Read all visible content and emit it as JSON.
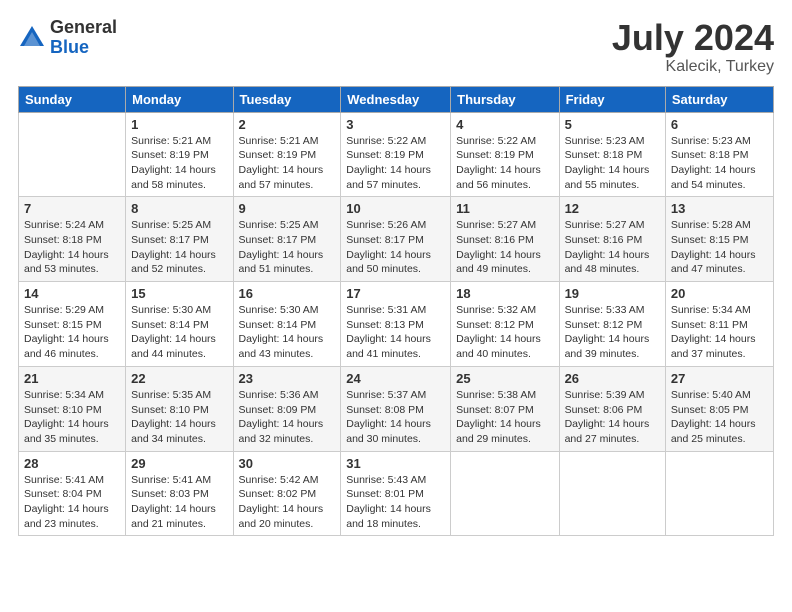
{
  "logo": {
    "general": "General",
    "blue": "Blue"
  },
  "title": {
    "month": "July 2024",
    "location": "Kalecik, Turkey"
  },
  "calendar": {
    "headers": [
      "Sunday",
      "Monday",
      "Tuesday",
      "Wednesday",
      "Thursday",
      "Friday",
      "Saturday"
    ],
    "weeks": [
      [
        {
          "day": "",
          "info": ""
        },
        {
          "day": "1",
          "info": "Sunrise: 5:21 AM\nSunset: 8:19 PM\nDaylight: 14 hours\nand 58 minutes."
        },
        {
          "day": "2",
          "info": "Sunrise: 5:21 AM\nSunset: 8:19 PM\nDaylight: 14 hours\nand 57 minutes."
        },
        {
          "day": "3",
          "info": "Sunrise: 5:22 AM\nSunset: 8:19 PM\nDaylight: 14 hours\nand 57 minutes."
        },
        {
          "day": "4",
          "info": "Sunrise: 5:22 AM\nSunset: 8:19 PM\nDaylight: 14 hours\nand 56 minutes."
        },
        {
          "day": "5",
          "info": "Sunrise: 5:23 AM\nSunset: 8:18 PM\nDaylight: 14 hours\nand 55 minutes."
        },
        {
          "day": "6",
          "info": "Sunrise: 5:23 AM\nSunset: 8:18 PM\nDaylight: 14 hours\nand 54 minutes."
        }
      ],
      [
        {
          "day": "7",
          "info": "Sunrise: 5:24 AM\nSunset: 8:18 PM\nDaylight: 14 hours\nand 53 minutes."
        },
        {
          "day": "8",
          "info": "Sunrise: 5:25 AM\nSunset: 8:17 PM\nDaylight: 14 hours\nand 52 minutes."
        },
        {
          "day": "9",
          "info": "Sunrise: 5:25 AM\nSunset: 8:17 PM\nDaylight: 14 hours\nand 51 minutes."
        },
        {
          "day": "10",
          "info": "Sunrise: 5:26 AM\nSunset: 8:17 PM\nDaylight: 14 hours\nand 50 minutes."
        },
        {
          "day": "11",
          "info": "Sunrise: 5:27 AM\nSunset: 8:16 PM\nDaylight: 14 hours\nand 49 minutes."
        },
        {
          "day": "12",
          "info": "Sunrise: 5:27 AM\nSunset: 8:16 PM\nDaylight: 14 hours\nand 48 minutes."
        },
        {
          "day": "13",
          "info": "Sunrise: 5:28 AM\nSunset: 8:15 PM\nDaylight: 14 hours\nand 47 minutes."
        }
      ],
      [
        {
          "day": "14",
          "info": "Sunrise: 5:29 AM\nSunset: 8:15 PM\nDaylight: 14 hours\nand 46 minutes."
        },
        {
          "day": "15",
          "info": "Sunrise: 5:30 AM\nSunset: 8:14 PM\nDaylight: 14 hours\nand 44 minutes."
        },
        {
          "day": "16",
          "info": "Sunrise: 5:30 AM\nSunset: 8:14 PM\nDaylight: 14 hours\nand 43 minutes."
        },
        {
          "day": "17",
          "info": "Sunrise: 5:31 AM\nSunset: 8:13 PM\nDaylight: 14 hours\nand 41 minutes."
        },
        {
          "day": "18",
          "info": "Sunrise: 5:32 AM\nSunset: 8:12 PM\nDaylight: 14 hours\nand 40 minutes."
        },
        {
          "day": "19",
          "info": "Sunrise: 5:33 AM\nSunset: 8:12 PM\nDaylight: 14 hours\nand 39 minutes."
        },
        {
          "day": "20",
          "info": "Sunrise: 5:34 AM\nSunset: 8:11 PM\nDaylight: 14 hours\nand 37 minutes."
        }
      ],
      [
        {
          "day": "21",
          "info": "Sunrise: 5:34 AM\nSunset: 8:10 PM\nDaylight: 14 hours\nand 35 minutes."
        },
        {
          "day": "22",
          "info": "Sunrise: 5:35 AM\nSunset: 8:10 PM\nDaylight: 14 hours\nand 34 minutes."
        },
        {
          "day": "23",
          "info": "Sunrise: 5:36 AM\nSunset: 8:09 PM\nDaylight: 14 hours\nand 32 minutes."
        },
        {
          "day": "24",
          "info": "Sunrise: 5:37 AM\nSunset: 8:08 PM\nDaylight: 14 hours\nand 30 minutes."
        },
        {
          "day": "25",
          "info": "Sunrise: 5:38 AM\nSunset: 8:07 PM\nDaylight: 14 hours\nand 29 minutes."
        },
        {
          "day": "26",
          "info": "Sunrise: 5:39 AM\nSunset: 8:06 PM\nDaylight: 14 hours\nand 27 minutes."
        },
        {
          "day": "27",
          "info": "Sunrise: 5:40 AM\nSunset: 8:05 PM\nDaylight: 14 hours\nand 25 minutes."
        }
      ],
      [
        {
          "day": "28",
          "info": "Sunrise: 5:41 AM\nSunset: 8:04 PM\nDaylight: 14 hours\nand 23 minutes."
        },
        {
          "day": "29",
          "info": "Sunrise: 5:41 AM\nSunset: 8:03 PM\nDaylight: 14 hours\nand 21 minutes."
        },
        {
          "day": "30",
          "info": "Sunrise: 5:42 AM\nSunset: 8:02 PM\nDaylight: 14 hours\nand 20 minutes."
        },
        {
          "day": "31",
          "info": "Sunrise: 5:43 AM\nSunset: 8:01 PM\nDaylight: 14 hours\nand 18 minutes."
        },
        {
          "day": "",
          "info": ""
        },
        {
          "day": "",
          "info": ""
        },
        {
          "day": "",
          "info": ""
        }
      ]
    ]
  }
}
